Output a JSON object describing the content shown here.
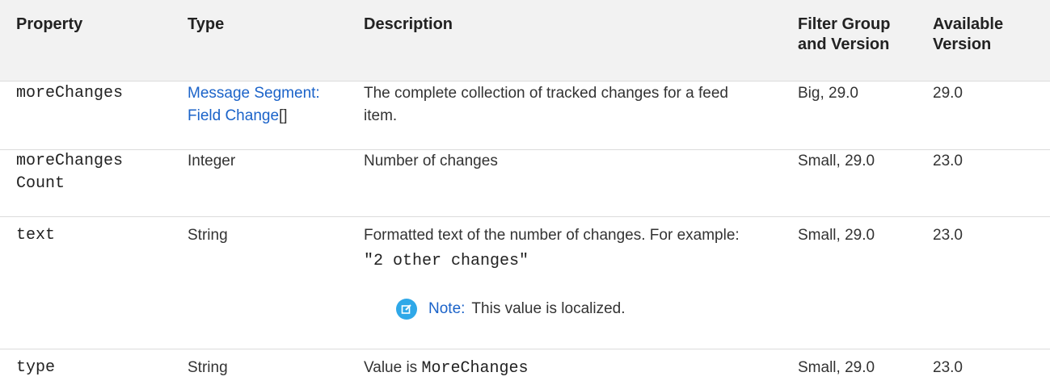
{
  "columns": {
    "property": "Property",
    "type": "Type",
    "description": "Description",
    "filter_line1": "Filter Group",
    "filter_line2": "and Version",
    "available_line1": "Available",
    "available_line2": "Version"
  },
  "rows": [
    {
      "property": "moreChanges",
      "type_link_line1": "Message Segment:",
      "type_link_line2": "Field Change",
      "type_suffix": "[]",
      "description_line1": "The complete collection of tracked changes for a feed",
      "description_line2": "item.",
      "filter": "Big, 29.0",
      "available": "29.0"
    },
    {
      "property_line1": "moreChanges",
      "property_line2": "Count",
      "type": "Integer",
      "description": "Number of changes",
      "filter": "Small, 29.0",
      "available": "23.0"
    },
    {
      "property": "text",
      "type": "String",
      "description": "Formatted text of the number of changes. For example:",
      "description_code": "\"2 other changes\"",
      "note_label": "Note:",
      "note_text": "This value is localized.",
      "filter": "Small, 29.0",
      "available": "23.0"
    },
    {
      "property": "type",
      "type": "String",
      "description_prefix": "Value is ",
      "description_code": "MoreChanges",
      "filter": "Small, 29.0",
      "available": "23.0"
    }
  ],
  "colors": {
    "link": "#1b63c9",
    "note_icon": "#2fa8e8",
    "header_bg": "#f2f2f2"
  },
  "icons": {
    "note": "edit-note-icon"
  }
}
